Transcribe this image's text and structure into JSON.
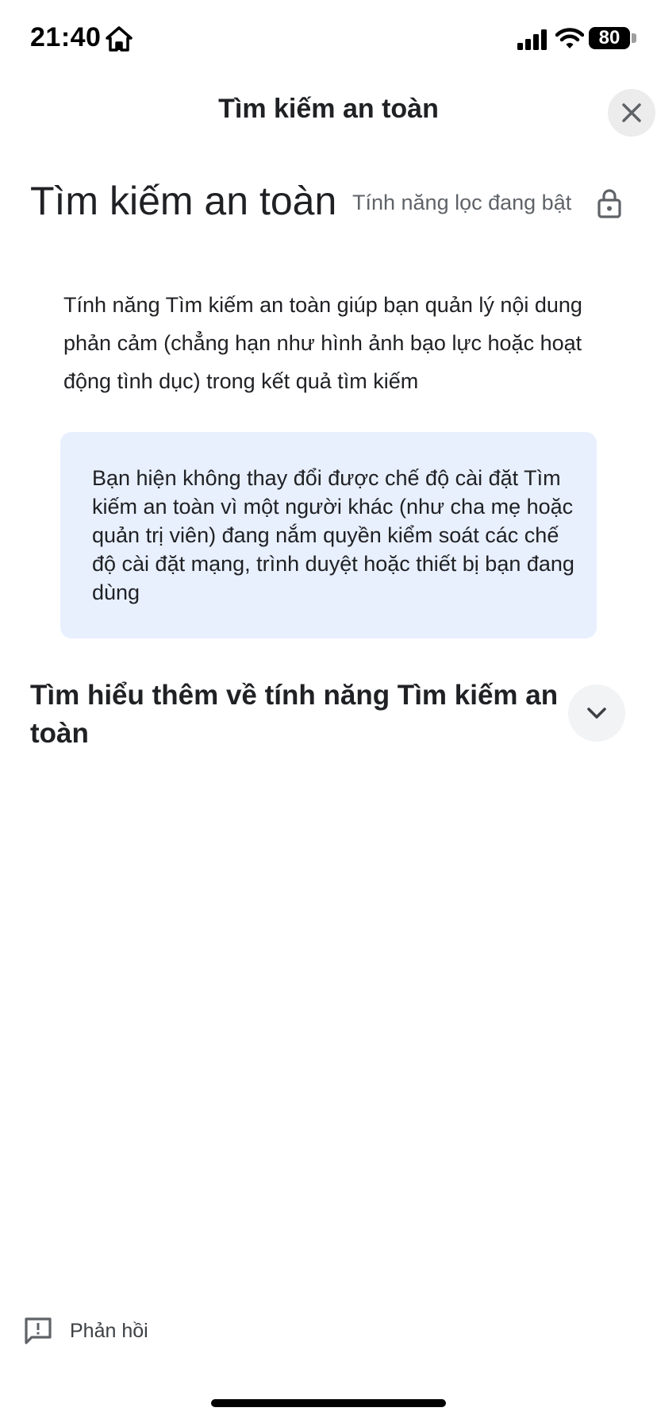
{
  "status_bar": {
    "time": "21:40",
    "battery_level": "80",
    "icons": [
      "home-icon",
      "signal-icon",
      "wifi-icon",
      "battery-icon"
    ]
  },
  "sheet": {
    "title": "Tìm kiếm an toàn",
    "close_icon": "close-icon"
  },
  "header": {
    "title": "Tìm kiếm an toàn",
    "filter_status": "Tính năng lọc đang bật",
    "lock_icon": "lock-icon"
  },
  "description": "Tính năng Tìm kiếm an toàn giúp bạn quản lý nội dung phản cảm (chẳng hạn như hình ảnh bạo lực hoặc hoạt động tình dục) trong kết quả tìm kiếm",
  "notice": {
    "text": "Bạn hiện không thay đổi được chế độ cài đặt Tìm kiếm an toàn vì một người khác (như cha mẹ hoặc quản trị viên) đang nắm quyền kiểm soát các chế độ cài đặt mạng, trình duyệt hoặc thiết bị bạn đang dùng",
    "background_color": "#e8f0fe"
  },
  "learn_more": {
    "title": "Tìm hiểu thêm về tính năng Tìm kiếm an toàn",
    "expand_icon": "chevron-down-icon"
  },
  "footer": {
    "feedback_label": "Phản hồi",
    "feedback_icon": "feedback-icon"
  }
}
